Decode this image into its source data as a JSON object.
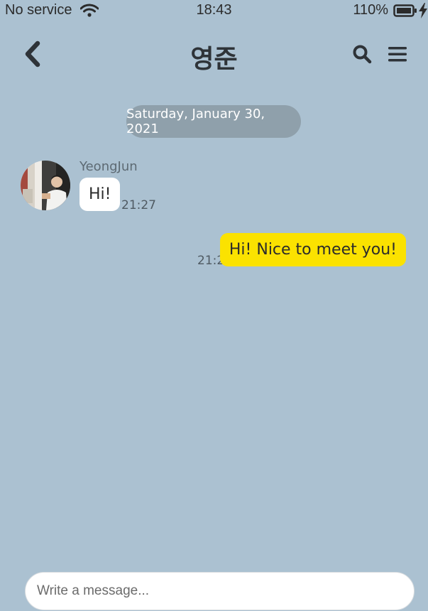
{
  "status_bar": {
    "carrier": "No service",
    "time": "18:43",
    "battery": "110%"
  },
  "header": {
    "title": "영준",
    "back_icon": "chevron-left-icon",
    "search_icon": "search-icon",
    "menu_icon": "hamburger-menu-icon"
  },
  "chat": {
    "date_label": "Saturday, January 30, 2021",
    "messages": [
      {
        "direction": "incoming",
        "sender": "YeongJun",
        "text": "Hi!",
        "time": "21:27"
      },
      {
        "direction": "outgoing",
        "text": "Hi! Nice to meet you!",
        "time": "21:27"
      }
    ]
  },
  "composer": {
    "placeholder": "Write a message...",
    "value": ""
  },
  "colors": {
    "background": "#abc1d1",
    "outgoing_bubble": "#fbe200",
    "incoming_bubble": "#ffffff",
    "date_pill": "#8fa0ab"
  }
}
